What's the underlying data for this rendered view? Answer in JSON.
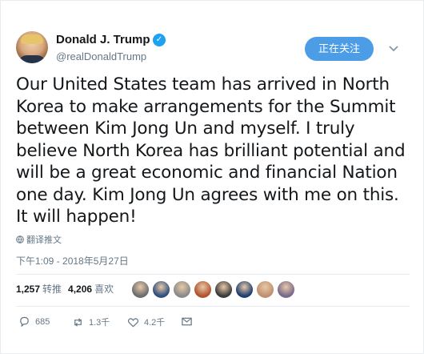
{
  "user": {
    "display_name": "Donald J. Trump",
    "handle": "@realDonaldTrump",
    "verified_glyph": "✓",
    "follow_label": "正在关注"
  },
  "tweet": {
    "text": "Our United States team has arrived in North Korea to make arrangements for the Summit between Kim Jong Un and myself. I truly believe North Korea has brilliant potential and will be a great economic and financial Nation one day. Kim Jong Un agrees with me on this. It will happen!",
    "translate_label": "翻译推文",
    "timestamp": "下午1:09 - 2018年5月27日"
  },
  "stats": {
    "retweets_count": "1,257",
    "retweets_label": "转推",
    "likes_count": "4,206",
    "likes_label": "喜欢"
  },
  "likers": [
    {
      "color": "#6d6d6d"
    },
    {
      "color": "#2f4f7f"
    },
    {
      "color": "#8a8a8a"
    },
    {
      "color": "#b2532f"
    },
    {
      "color": "#3b3b3b"
    },
    {
      "color": "#1f3f6f"
    },
    {
      "color": "#c09070"
    },
    {
      "color": "#7a6a8a"
    }
  ],
  "actions": {
    "reply_count": "685",
    "retweet_count": "1.3千",
    "like_count": "4.2千"
  },
  "colors": {
    "accent": "#1da1f2",
    "follow_button": "#4d9de6",
    "muted_text": "#657786"
  },
  "icons": {
    "verified": "verified-badge-icon",
    "menu": "chevron-down-icon",
    "translate": "globe-icon",
    "reply": "reply-icon",
    "retweet": "retweet-icon",
    "like": "heart-icon",
    "dm": "message-icon"
  }
}
